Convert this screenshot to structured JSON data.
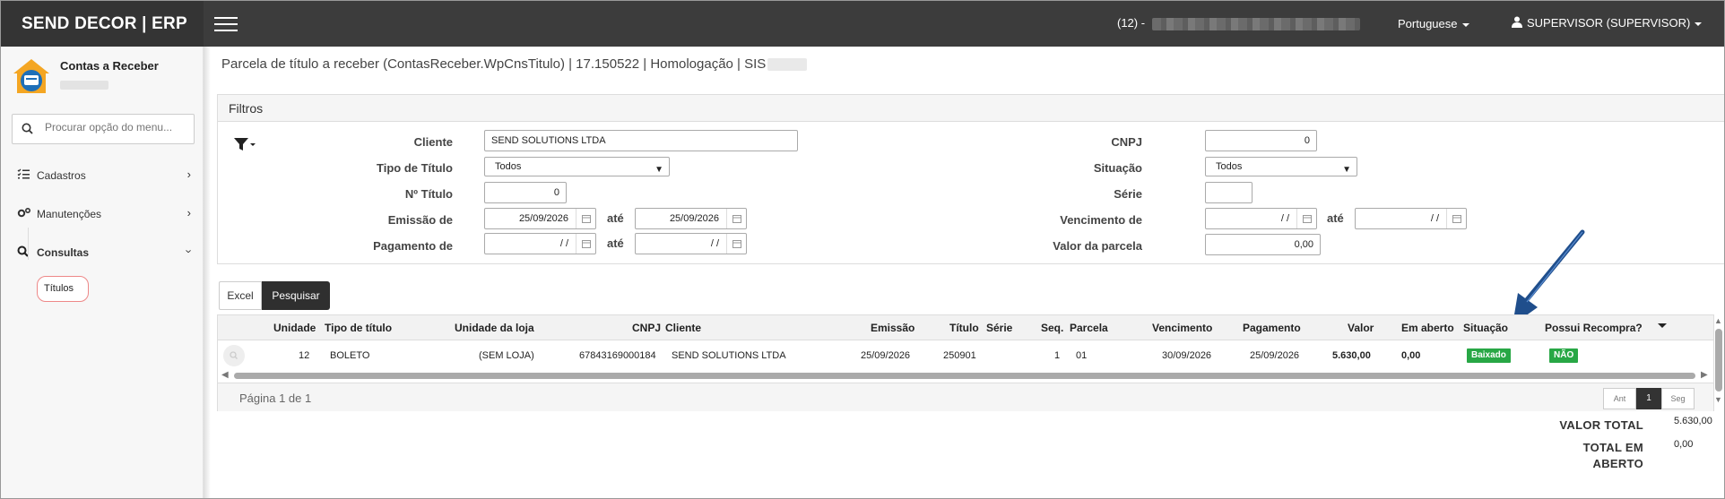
{
  "app": {
    "brand": "SEND DECOR | ERP",
    "company_prefix": "(12) -",
    "language": "Portuguese",
    "user": "SUPERVISOR (SUPERVISOR)"
  },
  "sidebar": {
    "module_title": "Contas a Receber",
    "search_placeholder": "Procurar opção do menu...",
    "items": [
      {
        "label": "Cadastros",
        "icon": "list-check-icon"
      },
      {
        "label": "Manutenções",
        "icon": "gears-icon"
      },
      {
        "label": "Consultas",
        "icon": "search-icon"
      }
    ],
    "subitem": "Títulos"
  },
  "page": {
    "breadcrumb": "Parcela de título a receber (ContasReceber.WpCnsTitulo) | 17.150522 | Homologação | SIS"
  },
  "filters": {
    "title": "Filtros",
    "cliente_label": "Cliente",
    "cliente_value": "SEND SOLUTIONS LTDA",
    "tipo_label": "Tipo de Título",
    "tipo_value": "Todos",
    "numero_label": "Nº Título",
    "numero_value": "0",
    "emissao_label": "Emissão de",
    "emissao_from": "25/09/2026",
    "emissao_to": "25/09/2026",
    "pagamento_label": "Pagamento de",
    "pagamento_from": "/ /",
    "pagamento_to": "/ /",
    "ate_label": "até",
    "cnpj_label": "CNPJ",
    "cnpj_value": "0",
    "situacao_label": "Situação",
    "situacao_value": "Todos",
    "serie_label": "Série",
    "serie_value": "",
    "vencimento_label": "Vencimento de",
    "vencimento_from": "/ /",
    "vencimento_to": "/ /",
    "valor_label": "Valor da parcela",
    "valor_value": "0,00"
  },
  "actions": {
    "excel": "Excel",
    "pesquisar": "Pesquisar"
  },
  "grid": {
    "headers": [
      "Unidade",
      "Tipo de título",
      "Unidade da loja",
      "CNPJ",
      "Cliente",
      "Emissão",
      "Título",
      "Série",
      "Seq.",
      "Parcela",
      "Vencimento",
      "Pagamento",
      "Valor",
      "Em aberto",
      "Situação",
      "Possui Recompra?"
    ],
    "row": {
      "unidade": "12",
      "tipo": "BOLETO",
      "loja": "(SEM LOJA)",
      "cnpj": "67843169000184",
      "cliente": "SEND SOLUTIONS LTDA",
      "emissao": "25/09/2026",
      "titulo": "250901",
      "serie": "",
      "seq": "1",
      "parcela": "01",
      "vencimento": "30/09/2026",
      "pagamento": "25/09/2026",
      "valor": "5.630,00",
      "em_aberto": "0,00",
      "situacao": "Baixado",
      "recompra": "NÃO"
    },
    "page_info": "Página 1 de 1",
    "pager": {
      "prev": "Ant",
      "current": "1",
      "next": "Seg"
    }
  },
  "totals": {
    "valor_total_label": "VALOR TOTAL",
    "valor_total": "5.630,00",
    "em_aberto_label_1": "TOTAL EM",
    "em_aberto_label_2": "ABERTO",
    "em_aberto": "0,00"
  },
  "colors": {
    "topbar": "#3c3c3c",
    "badge_green": "#28a745",
    "arrow_blue": "#1f4e8c"
  }
}
